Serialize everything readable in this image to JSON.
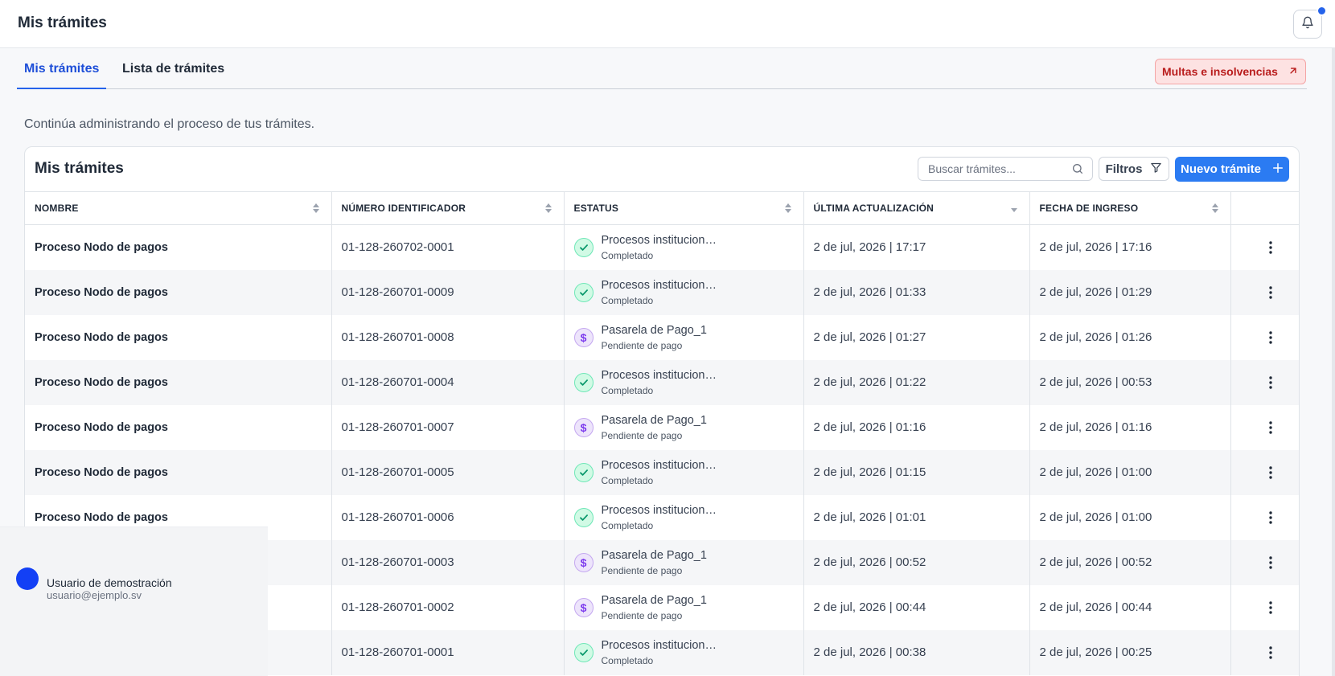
{
  "header": {
    "title": "Mis trámites",
    "bell_icon": "bell-icon"
  },
  "tabs": [
    {
      "label": "Mis trámites",
      "active": true
    },
    {
      "label": "Lista de trámites",
      "active": false
    }
  ],
  "external_button": {
    "label": "Multas e insolvencias",
    "icon": "arrow-up-right-icon"
  },
  "subtitle": "Continúa administrando el proceso de tus trámites.",
  "card": {
    "title": "Mis trámites",
    "search_placeholder": "Buscar trámites...",
    "filter_label": "Filtros",
    "new_label": "Nuevo trámite"
  },
  "table": {
    "columns": [
      "NOMBRE",
      "NÚMERO IDENTIFICADOR",
      "ESTATUS",
      "ÚLTIMA ACTUALIZACIÓN",
      "FECHA DE INGRESO"
    ],
    "rows": [
      {
        "name": "Proceso Nodo de pagos",
        "id": "01-128-260702-0001",
        "status_main": "Procesos institucional...",
        "status_sub": "Completado",
        "status_type": "done",
        "updated": "2 de jul, 2026 | 17:17",
        "entry": "2 de jul, 2026 | 17:16"
      },
      {
        "name": "Proceso Nodo de pagos",
        "id": "01-128-260701-0009",
        "status_main": "Procesos institucional...",
        "status_sub": "Completado",
        "status_type": "done",
        "updated": "2 de jul, 2026 | 01:33",
        "entry": "2 de jul, 2026 | 01:29"
      },
      {
        "name": "Proceso Nodo de pagos",
        "id": "01-128-260701-0008",
        "status_main": "Pasarela de Pago_1",
        "status_sub": "Pendiente de pago",
        "status_type": "pay",
        "updated": "2 de jul, 2026 | 01:27",
        "entry": "2 de jul, 2026 | 01:26"
      },
      {
        "name": "Proceso Nodo de pagos",
        "id": "01-128-260701-0004",
        "status_main": "Procesos institucional...",
        "status_sub": "Completado",
        "status_type": "done",
        "updated": "2 de jul, 2026 | 01:22",
        "entry": "2 de jul, 2026 | 00:53"
      },
      {
        "name": "Proceso Nodo de pagos",
        "id": "01-128-260701-0007",
        "status_main": "Pasarela de Pago_1",
        "status_sub": "Pendiente de pago",
        "status_type": "pay",
        "updated": "2 de jul, 2026 | 01:16",
        "entry": "2 de jul, 2026 | 01:16"
      },
      {
        "name": "Proceso Nodo de pagos",
        "id": "01-128-260701-0005",
        "status_main": "Procesos institucional...",
        "status_sub": "Completado",
        "status_type": "done",
        "updated": "2 de jul, 2026 | 01:15",
        "entry": "2 de jul, 2026 | 01:00"
      },
      {
        "name": "Proceso Nodo de pagos",
        "id": "01-128-260701-0006",
        "status_main": "Procesos institucional...",
        "status_sub": "Completado",
        "status_type": "done",
        "updated": "2 de jul, 2026 | 01:01",
        "entry": "2 de jul, 2026 | 01:00"
      },
      {
        "name": "",
        "id": "01-128-260701-0003",
        "status_main": "Pasarela de Pago_1",
        "status_sub": "Pendiente de pago",
        "status_type": "pay",
        "updated": "2 de jul, 2026 | 00:52",
        "entry": "2 de jul, 2026 | 00:52"
      },
      {
        "name": "",
        "id": "01-128-260701-0002",
        "status_main": "Pasarela de Pago_1",
        "status_sub": "Pendiente de pago",
        "status_type": "pay",
        "updated": "2 de jul, 2026 | 00:44",
        "entry": "2 de jul, 2026 | 00:44"
      },
      {
        "name": "",
        "id": "01-128-260701-0001",
        "status_main": "Procesos institucional...",
        "status_sub": "Completado",
        "status_type": "done",
        "updated": "2 de jul, 2026 | 00:38",
        "entry": "2 de jul, 2026 | 00:25"
      }
    ]
  },
  "user": {
    "name": "Usuario de demostración",
    "email": "usuario@ejemplo.sv"
  },
  "colors": {
    "accent": "#2b7bf2",
    "danger_bg": "#fde2e2",
    "danger_text": "#b91c1c",
    "success": "#10b981",
    "pay": "#7c3aed"
  }
}
